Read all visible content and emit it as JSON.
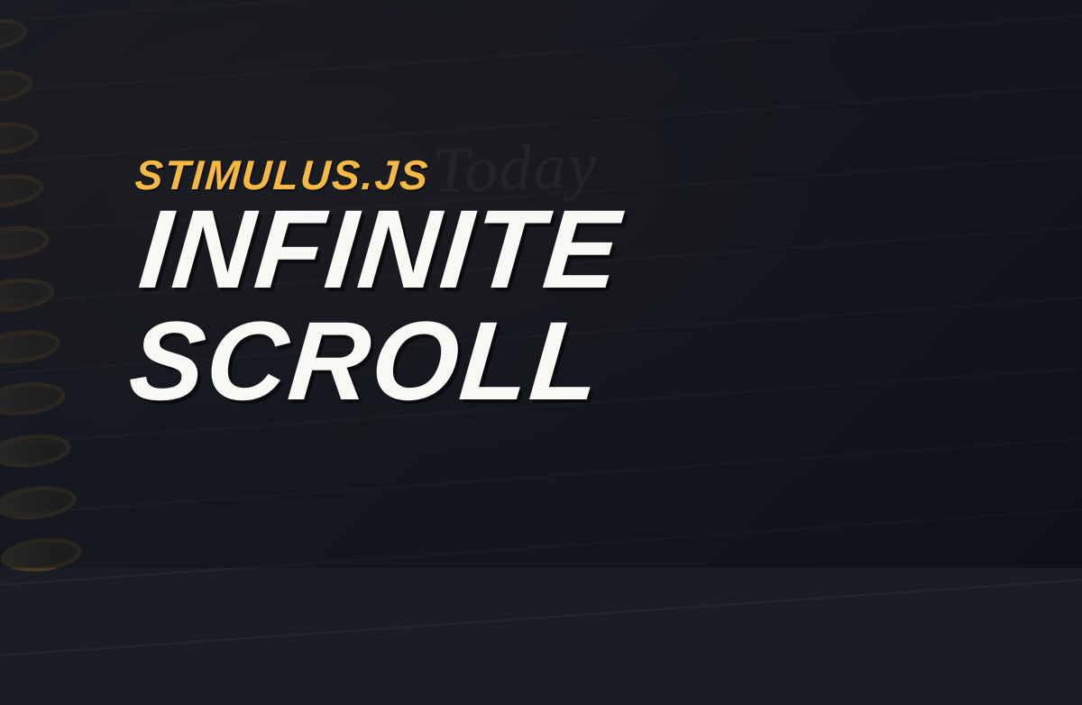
{
  "hero": {
    "eyebrow": "STIMULUS.JS",
    "title": "INFINITE SCROLL"
  },
  "background": {
    "handwriting": "Today"
  },
  "colors": {
    "accent": "#f5b942",
    "title": "#f8f8f5",
    "bg_dark": "#1a1d24"
  }
}
